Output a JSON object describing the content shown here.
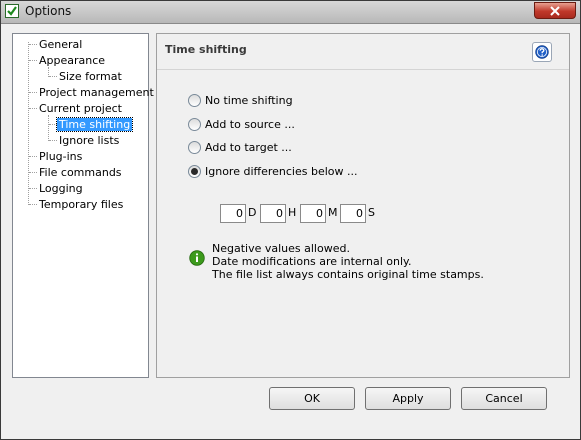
{
  "window": {
    "title": "Options",
    "close_glyph": "×"
  },
  "tree": {
    "items": [
      {
        "label": "General"
      },
      {
        "label": "Appearance"
      },
      {
        "label": "Size format"
      },
      {
        "label": "Project management"
      },
      {
        "label": "Current project"
      },
      {
        "label": "Time shifting",
        "selected": true
      },
      {
        "label": "Ignore lists"
      },
      {
        "label": "Plug-ins"
      },
      {
        "label": "File commands"
      },
      {
        "label": "Logging"
      },
      {
        "label": "Temporary files"
      }
    ]
  },
  "section": {
    "title": "Time shifting",
    "help_icon": "help-icon"
  },
  "options": [
    {
      "label": "No time shifting",
      "checked": false
    },
    {
      "label": "Add to source ...",
      "checked": false
    },
    {
      "label": "Add to target ...",
      "checked": false
    },
    {
      "label": "Ignore differencies below ...",
      "checked": true
    }
  ],
  "offset": {
    "days": {
      "value": "0",
      "unit": "D"
    },
    "hours": {
      "value": "0",
      "unit": "H"
    },
    "minutes": {
      "value": "0",
      "unit": "M"
    },
    "seconds": {
      "value": "0",
      "unit": "S"
    }
  },
  "info": {
    "icon": "info-icon",
    "lines": [
      "Negative values allowed.",
      "Date modifications are internal only.",
      "The file list always contains original time stamps."
    ]
  },
  "buttons": {
    "ok": "OK",
    "apply": "Apply",
    "cancel": "Cancel"
  },
  "colors": {
    "selection": "#3399ff",
    "info_green": "#3c9a1c",
    "help_blue": "#2060c8"
  }
}
